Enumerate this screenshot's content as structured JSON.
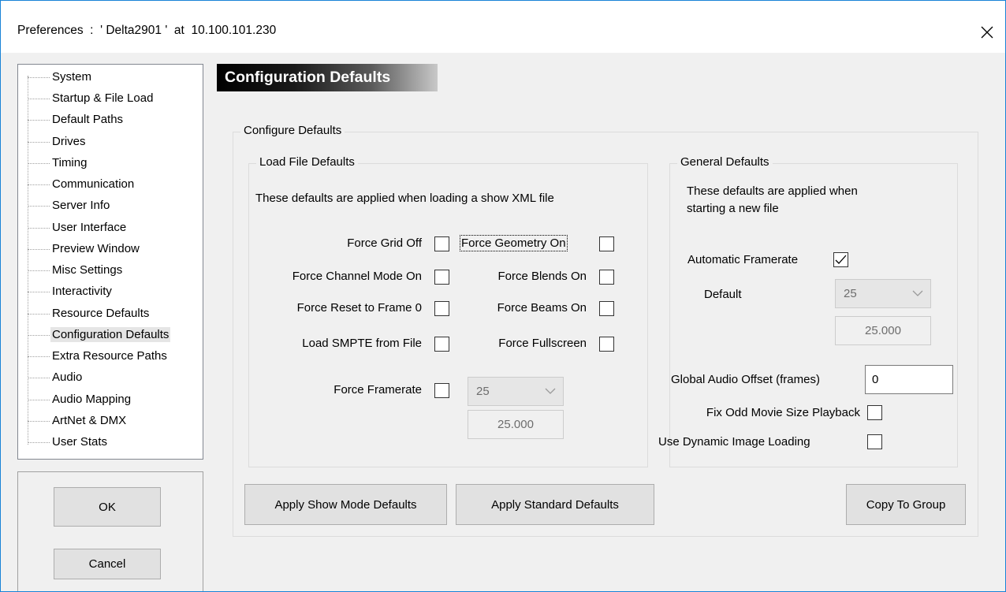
{
  "window": {
    "title": "Preferences  :  ' Delta2901 '  at  10.100.101.230",
    "close_icon": "close-icon"
  },
  "tree": {
    "selected": "Configuration Defaults",
    "items": [
      {
        "label": "System"
      },
      {
        "label": "Startup & File Load"
      },
      {
        "label": "Default Paths"
      },
      {
        "label": "Drives"
      },
      {
        "label": "Timing"
      },
      {
        "label": "Communication"
      },
      {
        "label": "Server Info"
      },
      {
        "label": "User Interface"
      },
      {
        "label": "Preview Window"
      },
      {
        "label": "Misc Settings"
      },
      {
        "label": "Interactivity"
      },
      {
        "label": "Resource Defaults"
      },
      {
        "label": "Configuration Defaults"
      },
      {
        "label": "Extra Resource Paths"
      },
      {
        "label": "Audio"
      },
      {
        "label": "Audio Mapping"
      },
      {
        "label": "ArtNet & DMX"
      },
      {
        "label": "User Stats"
      }
    ]
  },
  "buttons": {
    "ok": "OK",
    "cancel": "Cancel",
    "apply_show_mode": "Apply Show Mode Defaults",
    "apply_standard": "Apply Standard Defaults",
    "copy_to_group": "Copy To Group"
  },
  "page": {
    "header": "Configuration Defaults",
    "configure_group": "Configure Defaults"
  },
  "load_file_defaults": {
    "legend": "Load File Defaults",
    "description": "These defaults are applied when loading a show XML file",
    "force_grid_off": {
      "label": "Force Grid Off",
      "checked": false
    },
    "force_geometry_on": {
      "label": "Force Geometry On",
      "checked": false
    },
    "force_channel_mode_on": {
      "label": "Force Channel Mode On",
      "checked": false
    },
    "force_blends_on": {
      "label": "Force Blends On",
      "checked": false
    },
    "force_reset_frame0": {
      "label": "Force Reset to Frame 0",
      "checked": false
    },
    "force_beams_on": {
      "label": "Force Beams On",
      "checked": false
    },
    "load_smpte": {
      "label": "Load SMPTE from File",
      "checked": false
    },
    "force_fullscreen": {
      "label": "Force Fullscreen",
      "checked": false
    },
    "force_framerate": {
      "label": "Force Framerate",
      "checked": false
    },
    "framerate_select": "25",
    "framerate_value": "25.000"
  },
  "general_defaults": {
    "legend": "General Defaults",
    "description_line1": "These defaults are applied when",
    "description_line2": "starting a new file",
    "automatic_framerate": {
      "label": "Automatic Framerate",
      "checked": true
    },
    "default_label": "Default",
    "default_select": "25",
    "default_value": "25.000",
    "global_audio_offset_label": "Global Audio Offset (frames)",
    "global_audio_offset_value": "0",
    "fix_odd_movie": {
      "label": "Fix Odd Movie Size Playback",
      "checked": false
    },
    "dynamic_image_loading": {
      "label": "Use Dynamic Image Loading",
      "checked": false
    }
  },
  "colors": {
    "window_border": "#1883d7",
    "dialog_bg": "#f0f0f0",
    "selected_item_bg": "#e5e5e5"
  }
}
